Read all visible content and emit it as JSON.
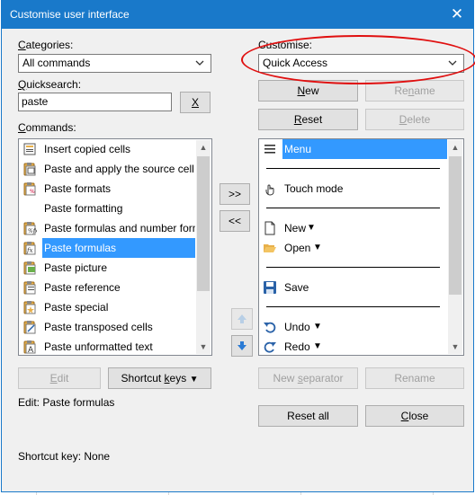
{
  "window": {
    "title": "Customise user interface",
    "close_glyph": "✕"
  },
  "left": {
    "categories_label_u": "C",
    "categories_label_rest": "ategories:",
    "categories_value": "All commands",
    "quicksearch_label_u": "Q",
    "quicksearch_label_rest": "uicksearch:",
    "quicksearch_value": "paste",
    "clear_button": "X",
    "commands_label_u": "C",
    "commands_label_rest": "ommands:",
    "commands": [
      {
        "label": "Insert copied cells",
        "icon": "insert-cells-icon"
      },
      {
        "label": "Paste and apply the source cell v",
        "icon": "paste-apply-icon"
      },
      {
        "label": "Paste formats",
        "icon": "paste-formats-icon"
      },
      {
        "label": "Paste formatting",
        "icon": ""
      },
      {
        "label": "Paste formulas and number form",
        "icon": "paste-formulas-number-icon"
      },
      {
        "label": "Paste formulas",
        "icon": "paste-formulas-icon",
        "selected": true
      },
      {
        "label": "Paste picture",
        "icon": "paste-picture-icon"
      },
      {
        "label": "Paste reference",
        "icon": "paste-reference-icon"
      },
      {
        "label": "Paste special",
        "icon": "paste-special-icon"
      },
      {
        "label": "Paste transposed cells",
        "icon": "paste-transposed-icon"
      },
      {
        "label": "Paste unformatted text",
        "icon": "paste-unformatted-icon"
      }
    ],
    "edit_button": "Edit",
    "shortcut_button": "Shortcut keys",
    "edit_status": "Edit: Paste formulas",
    "shortcut_status": "Shortcut key: None"
  },
  "middle": {
    "add_button": ">>",
    "remove_button": "<<"
  },
  "right": {
    "customise_label": "Customise:",
    "customise_value": "Quick Access",
    "new_button": "New",
    "rename_button": "Rename",
    "reset_button": "Reset",
    "delete_button": "Delete",
    "items": [
      {
        "label": "Menu",
        "icon": "hamburger-icon",
        "selected": true
      },
      {
        "separator": true
      },
      {
        "label": "Touch mode",
        "icon": "touch-hand-icon"
      },
      {
        "separator": true
      },
      {
        "label": "New",
        "icon": "new-document-icon",
        "dropdown": true
      },
      {
        "label": "Open",
        "icon": "folder-open-icon",
        "dropdown": true
      },
      {
        "separator": true
      },
      {
        "label": "Save",
        "icon": "save-icon"
      },
      {
        "separator": true
      },
      {
        "label": "Undo",
        "icon": "undo-icon",
        "dropdown": true
      },
      {
        "label": "Redo",
        "icon": "redo-icon",
        "dropdown": true
      }
    ],
    "new_separator_button": "New separator",
    "rename_item_button": "Rename",
    "reset_all_button": "Reset all",
    "close_button": "Close"
  },
  "colors": {
    "accent": "#1979ca",
    "selection": "#3399ff",
    "annotation": "#e01010"
  }
}
